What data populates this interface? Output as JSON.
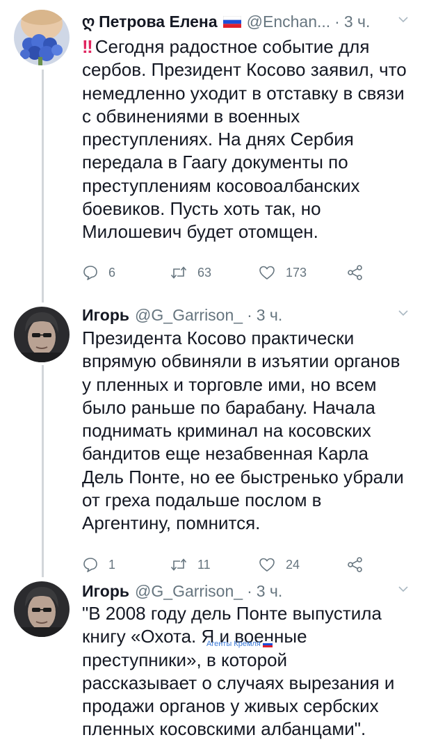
{
  "tweets": [
    {
      "author_icon": "omega-symbol",
      "author_prefix": "ღ",
      "name": "Петрова Елена",
      "flag": "russia-flag",
      "handle": "@Enchan...",
      "separator": "·",
      "time": "3 ч.",
      "emoji": "‼",
      "lines": [
        "Сегодня радостное событие для",
        "сербов. Президент Косово заявил, что",
        "немедленно уходит в отставку в связи",
        "с обвинениями в военных",
        "преступлениях. На днях Сербия",
        "передала в Гаагу документы по",
        "преступлениям косовоалбанских",
        "боевиков. Пусть хоть так, но",
        "Милошевич будет отомщен."
      ],
      "replies": "6",
      "retweets": "63",
      "likes": "173"
    },
    {
      "name": "Игорь",
      "handle": "@G_Garrison_",
      "separator": "·",
      "time": "3 ч.",
      "lines": [
        "Президента Косово практически",
        "впрямую обвиняли в изъятии органов",
        "у пленных и торговле ими, но всем",
        "было раньше по барабану. Начала",
        "поднимать криминал на косовских",
        "бандитов еще незабвенная Карла",
        "Дель Понте, но ее быстренько убрали",
        "от греха подальше послом в",
        "Аргентину, помнится."
      ],
      "replies": "1",
      "retweets": "11",
      "likes": "24"
    },
    {
      "name": "Игорь",
      "handle": "@G_Garrison_",
      "separator": "·",
      "time": "3 ч.",
      "lines": [
        "\"В 2008 году дель Понте выпустила",
        "книгу «Охота. Я и военные",
        "преступники», в которой",
        "рассказывает о случаях вырезания и",
        "продажи органов у живых сербских",
        "пленных косовскими албанцами\"."
      ]
    }
  ],
  "watermark": {
    "text": "Агенты Кремля",
    "flag": "russia-flag"
  },
  "colors": {
    "text": "#141823",
    "secondary": "#66757f",
    "thread_line": "#d2d6da",
    "emoji_red": "#e0245e",
    "watermark": "#3b7ad8"
  }
}
